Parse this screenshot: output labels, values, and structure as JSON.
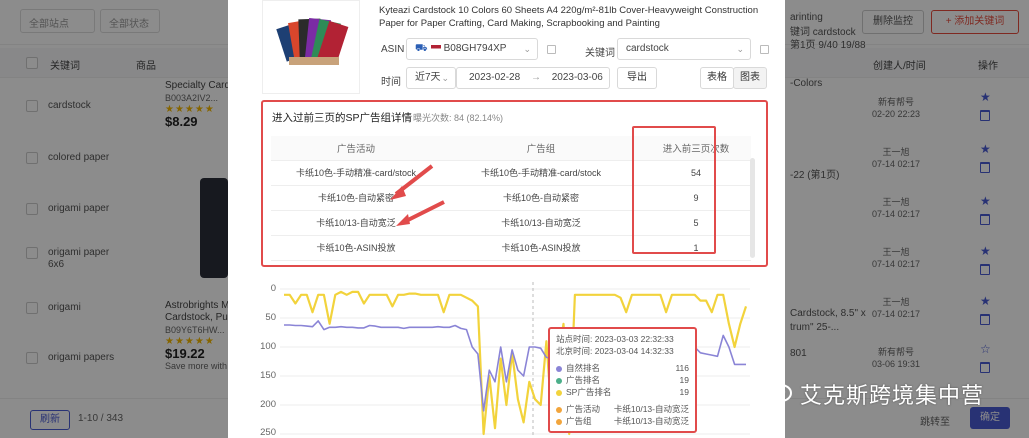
{
  "background": {
    "filters": [
      "全部站点",
      "全部状态"
    ],
    "header_buttons": {
      "delete_all": "删除监控",
      "add_keyword": "+ 添加关键词"
    },
    "columns": {
      "keyword": "关键词",
      "product": "商品",
      "creator": "创建人/时间",
      "action": "操作"
    },
    "keywords": [
      "cardstock",
      "colored paper",
      "origami paper",
      "origami paper 6x6",
      "origami",
      "origami papers"
    ],
    "products": [
      {
        "title": "Specialty Cardst...",
        "asin": "B003A2IV2...",
        "price": "$8.29"
      },
      {
        "title": "Astrobrights Me... Cardstock, Punc...",
        "asin": "B09Y6T6HW...",
        "price": "$19.22",
        "note": "Save more with"
      }
    ],
    "right_texts": [
      "arinting",
      "键词 cardstock",
      "第1页 9/40 19/88",
      "-Colors",
      "-22 (第1页)",
      "Cardstock, 8.5\" x",
      "trum\" 25-...",
      "801"
    ],
    "creators": [
      {
        "name": "新有帮号",
        "date": "02-20 22:23"
      },
      {
        "name": "王一旭",
        "date": "07-14 02:17"
      },
      {
        "name": "王一旭",
        "date": "07-14 02:17"
      },
      {
        "name": "王一旭",
        "date": "07-14 02:17"
      },
      {
        "name": "王一旭",
        "date": "07-14 02:17"
      },
      {
        "name": "新有帮号",
        "date": "03-06 19:31"
      }
    ],
    "footer": {
      "refresh": "刷新",
      "page_info": "1-10 / 343",
      "confirm": "确定",
      "goto": "跳转至"
    }
  },
  "product": {
    "title": "Kyteazi Cardstock 10 Colors 60 Sheets A4 220g/m²-81lb Cover-Heavyweight Construction Paper for Paper Crafting, Card Making, Scrapbooking and Painting",
    "asin_label": "ASIN",
    "asin_value": "B08GH794XP",
    "keyword_label": "关键词",
    "keyword_value": "cardstock"
  },
  "filters": {
    "time_label": "时间",
    "range": "近7天",
    "start_date": "2023-02-28",
    "date_sep": "→",
    "end_date": "2023-03-06",
    "export": "导出",
    "view_table": "表格",
    "view_chart": "图表"
  },
  "sp": {
    "title": "进入过前三页的SP广告组详情",
    "subtitle": "曝光次数: 84 (82.14%)",
    "headers": [
      "广告活动",
      "广告组",
      "进入前三页次数"
    ],
    "rows": [
      [
        "卡纸10色-手动精准-card/stock",
        "卡纸10色-手动精准-card/stock",
        "54"
      ],
      [
        "卡纸10色-自动紧密",
        "卡纸10色-自动紧密",
        "9"
      ],
      [
        "卡纸10/13-自动宽泛",
        "卡纸10/13-自动宽泛",
        "5"
      ],
      [
        "卡纸10色-ASIN投放",
        "卡纸10色-ASIN投放",
        "1"
      ]
    ]
  },
  "chart_data": {
    "type": "line",
    "yaxis_ticks": [
      "0",
      "50",
      "100",
      "150",
      "200",
      "250"
    ],
    "ylim": [
      0,
      250
    ],
    "y_inverted": true,
    "series": [
      {
        "name": "自然排名",
        "color": "#8a84d6",
        "values": [
          62,
          62,
          63,
          63,
          64,
          65,
          55,
          70,
          66,
          66,
          65,
          66,
          66,
          67,
          67,
          63,
          64,
          66,
          66,
          66,
          66,
          68,
          66,
          66,
          66,
          66,
          66,
          65,
          66,
          66,
          63,
          68,
          70,
          100,
          112,
          210,
          140,
          160,
          100,
          160,
          105,
          140,
          150,
          100,
          100,
          102,
          118,
          120,
          120,
          118,
          110,
          108,
          118,
          120,
          120,
          130,
          116,
          100,
          101,
          117,
          110,
          110,
          100,
          110,
          112,
          110,
          115,
          115,
          116,
          116,
          118,
          120,
          100,
          110,
          112,
          114,
          116,
          80,
          100,
          130,
          130,
          130
        ]
      },
      {
        "name": "SP广告排名",
        "color": "#f2d33c",
        "values": [
          10,
          10,
          25,
          10,
          10,
          40,
          10,
          10,
          60,
          10,
          5,
          10,
          5,
          5,
          25,
          10,
          10,
          10,
          10,
          30,
          10,
          10,
          8,
          8,
          10,
          10,
          10,
          10,
          40,
          10,
          10,
          10,
          15,
          20,
          30,
          250,
          150,
          240,
          120,
          200,
          110,
          190,
          230,
          160,
          190,
          200,
          90,
          230,
          120,
          60,
          250,
          10,
          10,
          10,
          10,
          10,
          10,
          10,
          10,
          15,
          40,
          10,
          10,
          10,
          10,
          10,
          10,
          40,
          10,
          10,
          10,
          10,
          10,
          20,
          20,
          40,
          10,
          10,
          60,
          100,
          60,
          30
        ]
      }
    ],
    "tooltip": {
      "site_time_label": "站点时间:",
      "site_time": "2023-03-03 22:32:33",
      "bj_time_label": "北京时间:",
      "bj_time": "2023-03-04 14:32:33",
      "items": [
        {
          "name": "自然排名",
          "value": "116",
          "color": "#8a84d6"
        },
        {
          "name": "广告排名",
          "value": "19",
          "color": "#4caf8a"
        },
        {
          "name": "SP广告排名",
          "value": "19",
          "color": "#f2d33c"
        }
      ],
      "detail": [
        {
          "name": "广告活动",
          "value": "卡纸10/13-自动宽泛",
          "color": "#f2a53c"
        },
        {
          "name": "广告组",
          "value": "卡纸10/13-自动宽泛",
          "color": "#f2a53c"
        }
      ]
    }
  },
  "watermark": "艾克斯跨境集中营",
  "colors": {
    "highlight": "#e14b4b",
    "accent": "#4a5bd4",
    "yellow_line": "#f2d33c",
    "purple_line": "#8a84d6"
  }
}
